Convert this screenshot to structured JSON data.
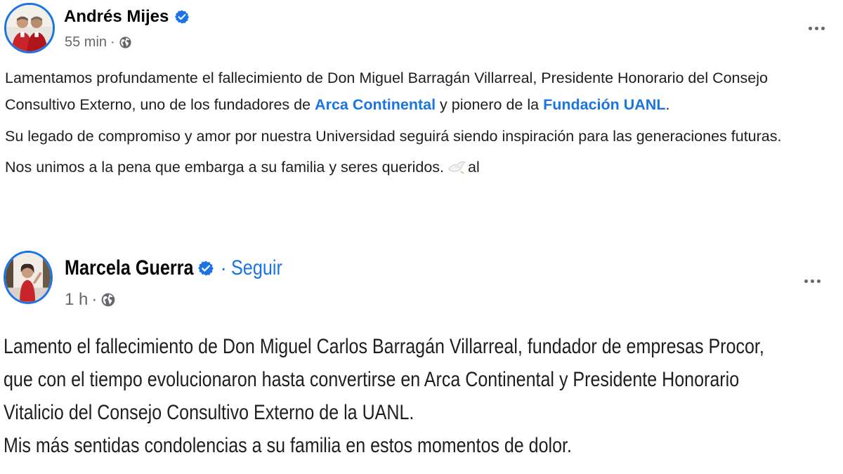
{
  "posts": [
    {
      "author": "Andrés Mijes",
      "verified": true,
      "time": "55 min",
      "separator": "·",
      "paragraphs": {
        "p1": {
          "before_mention1": "Lamentamos profundamente el fallecimiento de Don Miguel Barragán Villarreal, Presidente Honorario del Consejo Consultivo Externo, uno de los fundadores de ",
          "mention1": "Arca Continental",
          "between": " y pionero de la ",
          "mention2": "Fundación UANL",
          "after": "."
        },
        "p2": "Su legado de compromiso y amor por nuestra Universidad seguirá siendo inspiración para las generaciones futuras.",
        "p3": {
          "text": "Nos unimos a la pena que embarga a su familia y seres queridos.",
          "emoji": "dove-icon",
          "trailing": "al"
        }
      }
    },
    {
      "author": "Marcela Guerra",
      "verified": true,
      "follow_separator": "·",
      "follow_label": "Seguir",
      "time": "1 h",
      "separator": "·",
      "lines": [
        "Lamento el fallecimiento de Don Miguel Carlos Barragán Villarreal, fundador de empresas Procor,",
        "que con el tiempo evolucionaron hasta convertirse en Arca Continental y Presidente Honorario",
        "Vitalicio del Consejo Consultivo Externo de la UANL.",
        "Mis más sentidas condolencias a su  familia en estos momentos de dolor."
      ]
    }
  ],
  "colors": {
    "link": "#1b74e4",
    "text": "#1c1e21",
    "meta": "#65676b",
    "background": "#ffffff"
  }
}
